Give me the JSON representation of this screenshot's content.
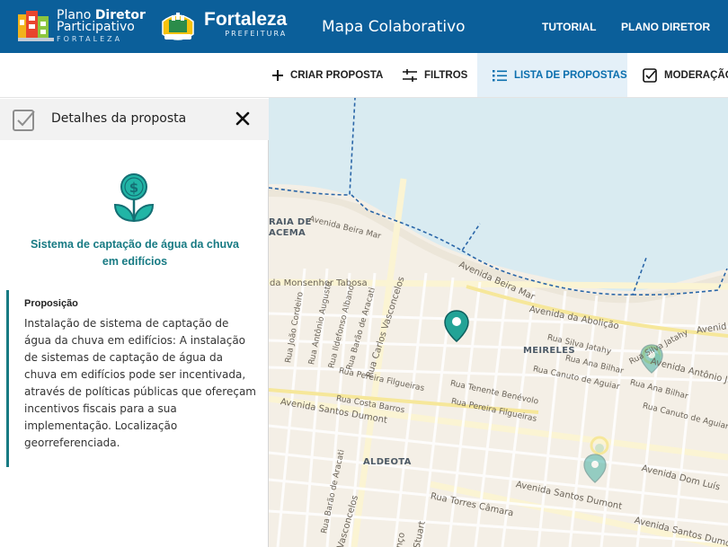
{
  "header": {
    "brand_plano": "Plano",
    "brand_diretor": "Diretor",
    "brand_participativo": "Participativo",
    "brand_city": "FORTALEZA",
    "city_name": "Fortaleza",
    "city_sub": "PREFEITURA",
    "app_title": "Mapa Colaborativo",
    "links": [
      "TUTORIAL",
      "PLANO DIRETOR"
    ]
  },
  "toolbar": {
    "criar": "CRIAR PROPOSTA",
    "filtros": "FILTROS",
    "lista": "LISTA DE PROPOSTAS",
    "moderacao": "MODERAÇÃO"
  },
  "panel": {
    "title": "Detalhes da proposta",
    "proposal_title": "Sistema de captação de água da chuva em edifícios",
    "section_label": "Proposição",
    "section_body": "Instalação de sistema de captação de água da chuva em edifícios: A instalação de sistemas de captação de água da chuva em edifícios pode ser incentivada, através de políticas públicas que ofereçam incentivos fiscais para a sua implementação. Localização georreferenciada."
  },
  "map": {
    "labels": {
      "praia_1": "RAIA DE",
      "praia_2": "ACEMA",
      "av_beira_mar_1": "Avenida Beira Mar",
      "av_beira_mar_2": "Avenida Beira Mar",
      "monsenhor": "da Monsenhor Tabosa",
      "carlos_vasc": "Rua Carlos Vasconcelos",
      "barao_aracati": "Rua Barão de Aracati",
      "ildefonso": "Rua Ildefonso Albano",
      "antonio_aug": "Rua Antônio Augusto",
      "joao_cordeiro": "Rua João Cordeiro",
      "pereira_filg_1": "Rua Pereira Filgueiras",
      "costa_barros": "Rua Costa Barros",
      "santos_dumont_1": "Avenida Santos Dumont",
      "abolicao": "Avenida da Abolição",
      "meireles": "MEIRELES",
      "silva_jatahy_1": "Rua Silva Jatahy",
      "ana_bilhar_1": "Rua Ana Bilhar",
      "canuto_1": "Rua Canuto de Aguiar",
      "tenente": "Rua Tenente Benévolo",
      "pereira_filg_2": "Rua Pereira Filgueiras",
      "silva_jatahy_2": "Rua Silva Jatahy",
      "ana_bilhar_2": "Rua Ana Bilhar",
      "canuto_2": "Rua Canuto de Aguiar",
      "av_antonio": "Avenida Antônio Ju",
      "avenid": "Avenid",
      "aldeota": "ALDEOTA",
      "santos_dumont_2": "Avenida Santos Dumont",
      "santos_dumont_3": "Avenida Santos Dumo",
      "dom_luis": "Avenida Dom Luís",
      "torres_camara": "Rua Torres Câmara",
      "barao_aracati_2": "Rua Barão de Aracati",
      "vasconcelos_2": "Vasconcelos",
      "stuart": "Stuart",
      "nco": "nço"
    }
  },
  "colors": {
    "header_bg": "#0b5f9a",
    "accent": "#177a83",
    "active_tab_bg": "#e4f0f8",
    "sea": "#d9ebf1",
    "boundary": "#2a66a8"
  }
}
